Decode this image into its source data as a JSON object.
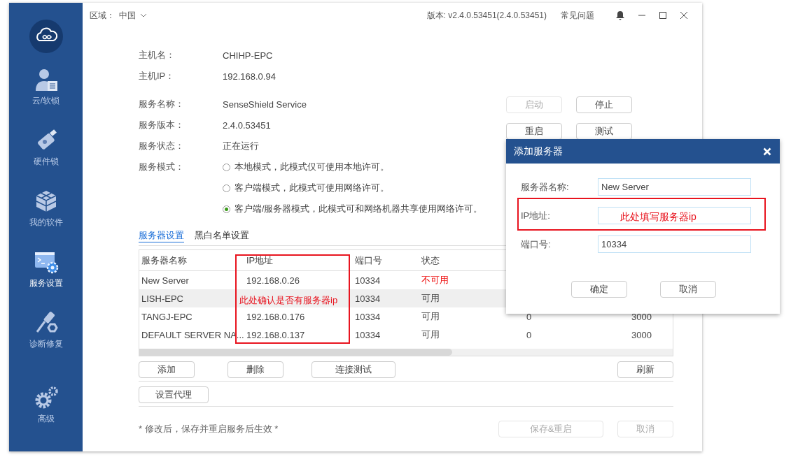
{
  "topbar": {
    "region_label": "区域：",
    "region_value": "中国",
    "version": "版本: v2.4.0.53451(2.4.0.53451)",
    "faq": "常见问题"
  },
  "sidebar": {
    "items": [
      {
        "label": "云/软锁",
        "kind": "user",
        "selected": false
      },
      {
        "label": "硬件锁",
        "kind": "usb",
        "selected": false
      },
      {
        "label": "我的软件",
        "kind": "cubes",
        "selected": false
      },
      {
        "label": "服务设置",
        "kind": "console",
        "selected": true
      },
      {
        "label": "诊断修复",
        "kind": "tools",
        "selected": false
      }
    ],
    "bottom_item": {
      "label": "高级",
      "kind": "gears",
      "selected": false
    }
  },
  "host_info": [
    {
      "label": "主机名：",
      "value": "CHIHP-EPC"
    },
    {
      "label": "主机IP：",
      "value": "192.168.0.94"
    }
  ],
  "service_info": [
    {
      "label": "服务名称：",
      "value": "SenseShield Service"
    },
    {
      "label": "服务版本：",
      "value": "2.4.0.53451"
    },
    {
      "label": "服务状态：",
      "value": "正在运行"
    }
  ],
  "service_mode": {
    "label": "服务模式：",
    "options": [
      {
        "label": "本地模式，此模式仅可使用本地许可。",
        "selected": false
      },
      {
        "label": "客户端模式，此模式可使用网络许可。",
        "selected": false
      },
      {
        "label": "客户端/服务器模式，此模式可和网络机器共享使用网络许可。",
        "selected": true
      }
    ]
  },
  "service_buttons": [
    {
      "label": "启动",
      "disabled": true
    },
    {
      "label": "停止",
      "disabled": false
    },
    {
      "label": "重启",
      "disabled": false
    },
    {
      "label": "测试",
      "disabled": false
    }
  ],
  "tabs": [
    {
      "label": "服务器设置",
      "selected": true
    },
    {
      "label": "黑白名单设置",
      "selected": false
    }
  ],
  "table": {
    "columns": [
      "服务器名称",
      "IP地址",
      "端口号",
      "状态"
    ],
    "rows": [
      {
        "name": "New Server",
        "ip": "192.168.0.26",
        "port": "10334",
        "status": "不可用",
        "available": false,
        "selected": false
      },
      {
        "name": "LISH-EPC",
        "port": "10334",
        "status": "可用",
        "available": true,
        "selected": true
      },
      {
        "name": "TANGJ-EPC",
        "ip": "192.168.0.176",
        "port": "10334",
        "status": "可用",
        "available": true,
        "selected": false,
        "column_5": "0",
        "column_6": "3000"
      },
      {
        "name": "DEFAULT SERVER NA...",
        "ip": "192.168.0.137",
        "port": "10334",
        "status": "可用",
        "available": true,
        "selected": false,
        "column_5": "0",
        "column_6": "3000"
      }
    ]
  },
  "table_buttons": [
    "添加",
    "删除",
    "连接测试"
  ],
  "refresh_button": "刷新",
  "proxy_button": "设置代理",
  "footer": {
    "note": "* 修改后，保存并重启服务后生效 *",
    "buttons": [
      {
        "label": "保存&重启",
        "disabled": true
      },
      {
        "label": "取消",
        "disabled": true
      }
    ]
  },
  "dialog": {
    "title": "添加服务器",
    "fields": [
      {
        "label": "服务器名称:",
        "value": "New Server"
      },
      {
        "label": "IP地址:"
      },
      {
        "label": "端口号:",
        "value": "10334"
      }
    ],
    "buttons": [
      "确定",
      "取消"
    ]
  },
  "annotations": [
    {
      "text": "此处确认是否有服务器ip"
    },
    {
      "text": "此处填写服务器ip"
    }
  ]
}
